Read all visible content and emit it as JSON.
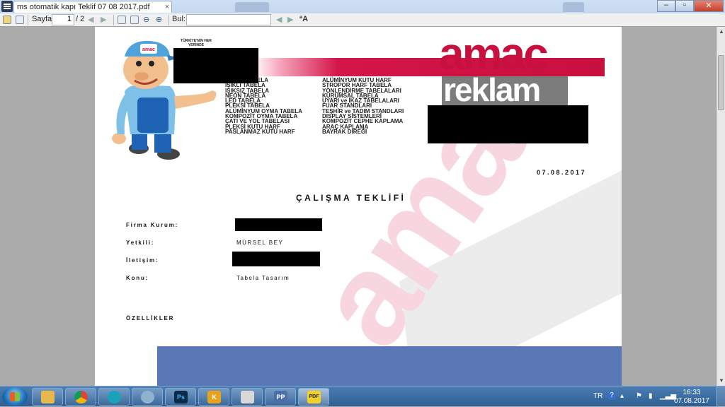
{
  "window": {
    "tab_title": "ms otomatik kapı Teklif 07 08 2017.pdf",
    "tab_close": "×",
    "controls": {
      "minimize": "–",
      "restore": "▫",
      "close": "✕"
    }
  },
  "toolbar": {
    "page_label": "Sayfa:",
    "page_current": "1",
    "page_total": "/ 2",
    "find_label": "Bul:",
    "find_value": "",
    "icons": [
      "open-icon",
      "print-icon",
      "prev-page-icon",
      "next-page-icon",
      "fit-page-icon",
      "fit-width-icon",
      "zoom-out-icon",
      "zoom-in-icon",
      "find-prev-icon",
      "find-next-icon",
      "match-case-icon"
    ]
  },
  "document": {
    "logo": {
      "line1": "amaç",
      "line2": "reklam"
    },
    "mascot_tagline": "TÜRKİYE'NİN HER YERİNDE",
    "services_left": [
      "IŞIKLI TABELA",
      "IŞIKSIZ TABELA",
      "NEON TABELA",
      "LED TABELA",
      "PLEKSİ TABELA",
      "ALÜMİNYUM OYMA TABELA",
      "KOMPOZİT OYMA TABELA",
      "ÇATI VE YOL TABELASI",
      "PLEKSİ KUTU HARF",
      "PASLANMAZ KUTU HARF"
    ],
    "services_right": [
      "ALÜMİNYUM KUTU HARF",
      "STROPOR HARF TABELA",
      "YÖNLENDİRME TABELALARI",
      "KURUMSAL TABELA",
      "UYARI ve İKAZ TABELALARI",
      "FUAR STANDLARI",
      "TEŞHİR ve TADIM STANDLARI",
      "DISPLAY SİSTEMLERİ",
      "KOMPOZİT CEPHE KAPLAMA",
      "ARAÇ KAPLAMA",
      "BAYRAK DİREĞİ"
    ],
    "services_left_first_visible": "ELA",
    "date": "07.08.2017",
    "title": "ÇALIŞMA TEKLİFİ",
    "fields": {
      "firma_label": "Firma Kurum:",
      "yetkili_label": "Yetkili:",
      "yetkili_value": "MÜRSEL BEY",
      "iletisim_label": "İletişim:",
      "konu_label": "Konu:",
      "konu_value": "Tabela Tasarım"
    },
    "section": "ÖZELLİKLER",
    "watermark": "amaç"
  },
  "taskbar": {
    "apps": [
      {
        "name": "explorer",
        "label": ""
      },
      {
        "name": "chrome",
        "label": ""
      },
      {
        "name": "app-3",
        "label": ""
      },
      {
        "name": "app-4",
        "label": ""
      },
      {
        "name": "photoshop",
        "label": "Ps"
      },
      {
        "name": "k-lite",
        "label": "K"
      },
      {
        "name": "printer",
        "label": ""
      },
      {
        "name": "pp",
        "label": "PP"
      },
      {
        "name": "pdf",
        "label": "PDF"
      }
    ],
    "tray": {
      "language": "TR",
      "help": "?"
    },
    "clock": {
      "time": "16:33",
      "date": "07.08.2017"
    }
  },
  "colors": {
    "brand_red": "#c8103f",
    "brand_gray": "#7c7c7c",
    "band_blue": "#5978b5"
  }
}
